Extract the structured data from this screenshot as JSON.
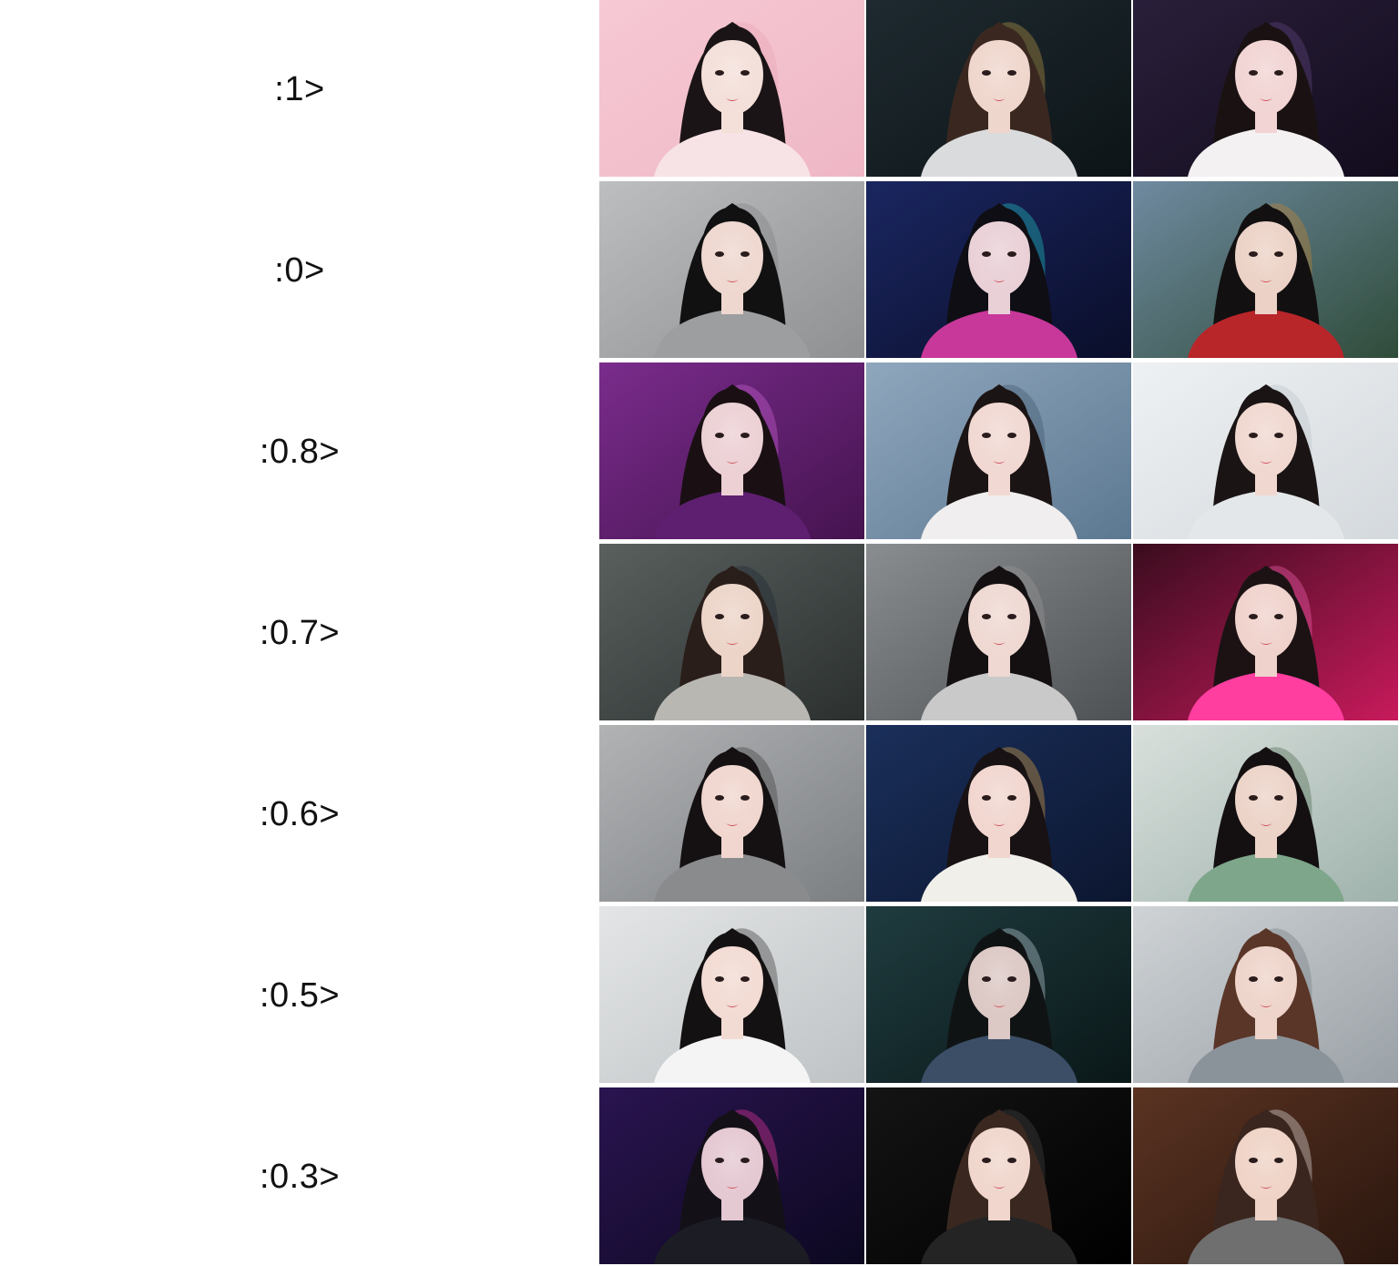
{
  "rows": [
    {
      "label": ":1>",
      "images": [
        {
          "desc": "portrait-pink-background",
          "bg": [
            "#f6c9d4",
            "#efb7c6"
          ],
          "hair": "#1b1416",
          "skin": "#f4dfd9",
          "cloth": "#f7e3e6",
          "accent": "#e8a0b0"
        },
        {
          "desc": "portrait-dark-teal-with-golden-feather",
          "bg": [
            "#1e2a30",
            "#0d1417"
          ],
          "hair": "#3a2820",
          "skin": "#efd6cc",
          "cloth": "#d9dbdc",
          "accent": "#c9a24a"
        },
        {
          "desc": "portrait-dark-purple-background",
          "bg": [
            "#2a1f3a",
            "#120c1d"
          ],
          "hair": "#1a1212",
          "skin": "#f1d4d3",
          "cloth": "#f3f1f2",
          "accent": "#6a4a8a"
        }
      ]
    },
    {
      "label": ":0>",
      "images": [
        {
          "desc": "portrait-grey-sweater",
          "bg": [
            "#bcbec0",
            "#8e9092"
          ],
          "hair": "#111111",
          "skin": "#eed7cf",
          "cloth": "#9c9ea0",
          "accent": "#7d7f81"
        },
        {
          "desc": "portrait-neon-cyan-magenta",
          "bg": [
            "#1a2660",
            "#0a0e2a"
          ],
          "hair": "#0e0e14",
          "skin": "#e9d0d6",
          "cloth": "#c8389a",
          "accent": "#22d6d0"
        },
        {
          "desc": "woman-in-red-at-temple-by-lake",
          "bg": [
            "#6f8aa0",
            "#2f4c3a"
          ],
          "hair": "#121010",
          "skin": "#ecd2c6",
          "cloth": "#b8262a",
          "accent": "#d0882a"
        }
      ]
    },
    {
      "label": ":0.8>",
      "images": [
        {
          "desc": "portrait-purple-fabric",
          "bg": [
            "#7a2c8c",
            "#45134f"
          ],
          "hair": "#1a1014",
          "skin": "#ecd0d4",
          "cloth": "#5e1f70",
          "accent": "#d76be0"
        },
        {
          "desc": "portrait-blue-grey-background",
          "bg": [
            "#8fa7bd",
            "#5c7891"
          ],
          "hair": "#1b1414",
          "skin": "#f1d8d2",
          "cloth": "#f0eeee",
          "accent": "#3a4f63"
        },
        {
          "desc": "portrait-white-sheer-blouse",
          "bg": [
            "#eef1f3",
            "#d4d9dd"
          ],
          "hair": "#1a1414",
          "skin": "#f0d8d0",
          "cloth": "#e4e7ea",
          "accent": "#b8bfc6"
        }
      ]
    },
    {
      "label": ":0.7>",
      "images": [
        {
          "desc": "portrait-subway-grey-coat",
          "bg": [
            "#59605e",
            "#2b302f"
          ],
          "hair": "#2a1e1a",
          "skin": "#ecd4c8",
          "cloth": "#b9b7b2",
          "accent": "#1b2530"
        },
        {
          "desc": "portrait-grey-studio",
          "bg": [
            "#8a8d90",
            "#4e5154"
          ],
          "hair": "#141012",
          "skin": "#efd8d2",
          "cloth": "#c9c9c9",
          "accent": "#9c9c9c"
        },
        {
          "desc": "portrait-neon-pink-diner",
          "bg": [
            "#3a0c1e",
            "#c81a5c"
          ],
          "hair": "#1c1214",
          "skin": "#f0d2cc",
          "cloth": "#ff3ea0",
          "accent": "#ff6ac0"
        }
      ]
    },
    {
      "label": ":0.6>",
      "images": [
        {
          "desc": "portrait-grey-knit-jacket",
          "bg": [
            "#b1b3b5",
            "#7c7f82"
          ],
          "hair": "#151112",
          "skin": "#f0d6ce",
          "cloth": "#8a8b8d",
          "accent": "#333333"
        },
        {
          "desc": "portrait-carousel-lights",
          "bg": [
            "#1a2f5a",
            "#0c1630"
          ],
          "hair": "#181214",
          "skin": "#f1d6cf",
          "cloth": "#f1efe9",
          "accent": "#f0b040"
        },
        {
          "desc": "woman-green-dress-by-window",
          "bg": [
            "#d9e0dc",
            "#9fb2ac"
          ],
          "hair": "#141012",
          "skin": "#ecd3c8",
          "cloth": "#7ea68a",
          "accent": "#3f5f40"
        }
      ]
    },
    {
      "label": ":0.5>",
      "images": [
        {
          "desc": "portrait-white-shirt-bob-hair",
          "bg": [
            "#e3e5e6",
            "#bfc3c5"
          ],
          "hair": "#141112",
          "skin": "#f2dbd3",
          "cloth": "#f4f4f4",
          "accent": "#222222"
        },
        {
          "desc": "portrait-dark-forest-moon",
          "bg": [
            "#1f3c3f",
            "#0a1718"
          ],
          "hair": "#101314",
          "skin": "#dcc8c4",
          "cloth": "#3b4e66",
          "accent": "#cfe0e8"
        },
        {
          "desc": "portrait-flowing-hair-grey-blouse",
          "bg": [
            "#cfd3d6",
            "#9aa1a6"
          ],
          "hair": "#5a3628",
          "skin": "#eed4ca",
          "cloth": "#8b939a",
          "accent": "#6d757c"
        }
      ]
    },
    {
      "label": ":0.3>",
      "images": [
        {
          "desc": "portrait-neon-wings",
          "bg": [
            "#2a1450",
            "#0c0820"
          ],
          "hair": "#141018",
          "skin": "#e4c8d2",
          "cloth": "#1c1c24",
          "accent": "#ff3ca8"
        },
        {
          "desc": "portrait-black-background-leather",
          "bg": [
            "#141414",
            "#000000"
          ],
          "hair": "#3a2820",
          "skin": "#f0d6cc",
          "cloth": "#242424",
          "accent": "#4a4a4a"
        },
        {
          "desc": "portrait-brown-room-grey-blazer",
          "bg": [
            "#5a3322",
            "#2a160e"
          ],
          "hair": "#3a261e",
          "skin": "#efd3c6",
          "cloth": "#6f6f70",
          "accent": "#f2f2f2"
        }
      ]
    }
  ]
}
